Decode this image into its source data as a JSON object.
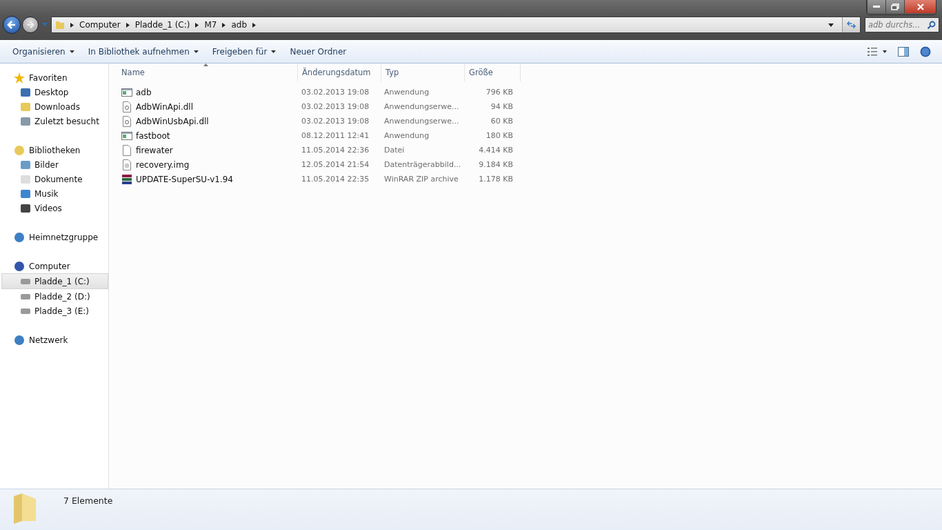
{
  "address_bar": {
    "crumbs": [
      "Computer",
      "Pladde_1 (C:)",
      "M7",
      "adb"
    ]
  },
  "search": {
    "placeholder": "adb durchs..."
  },
  "toolbar": {
    "items": [
      {
        "label": "Organisieren",
        "dropdown": true
      },
      {
        "label": "In Bibliothek aufnehmen",
        "dropdown": true
      },
      {
        "label": "Freigeben für",
        "dropdown": true
      },
      {
        "label": "Neuer Ordner",
        "dropdown": false
      }
    ]
  },
  "sidebar": {
    "groups": [
      {
        "label": "Favoriten",
        "kind": "star",
        "children": [
          {
            "label": "Desktop",
            "kind": "desktop",
            "selected": false
          },
          {
            "label": "Downloads",
            "kind": "folder",
            "selected": false
          },
          {
            "label": "Zuletzt besucht",
            "kind": "recent",
            "selected": false
          }
        ]
      },
      {
        "label": "Bibliotheken",
        "kind": "folder",
        "children": [
          {
            "label": "Bilder",
            "kind": "pictures",
            "selected": false
          },
          {
            "label": "Dokumente",
            "kind": "document",
            "selected": false
          },
          {
            "label": "Musik",
            "kind": "music",
            "selected": false
          },
          {
            "label": "Videos",
            "kind": "video",
            "selected": false
          }
        ]
      },
      {
        "label": "Heimnetzgruppe",
        "kind": "network"
      },
      {
        "label": "Computer",
        "kind": "computer",
        "children": [
          {
            "label": "Pladde_1 (C:)",
            "kind": "drive",
            "selected": true
          },
          {
            "label": "Pladde_2 (D:)",
            "kind": "drive",
            "selected": false
          },
          {
            "label": "Pladde_3 (E:)",
            "kind": "drive",
            "selected": false
          }
        ]
      },
      {
        "label": "Netzwerk",
        "kind": "network"
      }
    ]
  },
  "table": {
    "columns": [
      {
        "label": "Name",
        "sorted": true
      },
      {
        "label": "Änderungsdatum",
        "sorted": false
      },
      {
        "label": "Typ",
        "sorted": false
      },
      {
        "label": "Größe",
        "sorted": false
      }
    ],
    "rows": [
      {
        "name": "adb",
        "kind": "exe",
        "date": "03.02.2013 19:08",
        "type": "Anwendung",
        "size": "796 KB"
      },
      {
        "name": "AdbWinApi.dll",
        "kind": "dll",
        "date": "03.02.2013 19:08",
        "type": "Anwendungserwe...",
        "size": "94 KB"
      },
      {
        "name": "AdbWinUsbApi.dll",
        "kind": "dll",
        "date": "03.02.2013 19:08",
        "type": "Anwendungserwe...",
        "size": "60 KB"
      },
      {
        "name": "fastboot",
        "kind": "exe",
        "date": "08.12.2011 12:41",
        "type": "Anwendung",
        "size": "180 KB"
      },
      {
        "name": "firewater",
        "kind": "blank",
        "date": "11.05.2014 22:36",
        "type": "Datei",
        "size": "4.414 KB"
      },
      {
        "name": "recovery.img",
        "kind": "image",
        "date": "12.05.2014 21:54",
        "type": "Datenträgerabbild...",
        "size": "9.184 KB"
      },
      {
        "name": "UPDATE-SuperSU-v1.94",
        "kind": "archive",
        "date": "11.05.2014 22:35",
        "type": "WinRAR ZIP archive",
        "size": "1.178 KB"
      }
    ]
  },
  "status_bar": {
    "count": "7 Elemente"
  }
}
